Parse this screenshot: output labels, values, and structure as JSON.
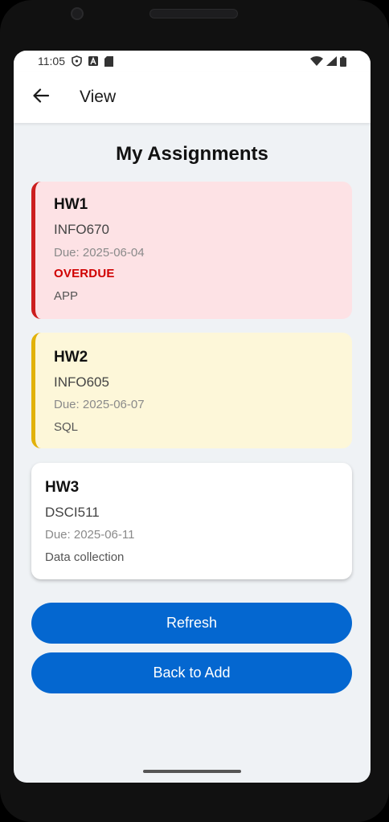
{
  "status_bar": {
    "time": "11:05",
    "left_icons": [
      "shield-icon",
      "a-badge-icon",
      "sd-card-icon"
    ],
    "right_icons": [
      "wifi-icon",
      "signal-icon",
      "battery-icon"
    ]
  },
  "app_bar": {
    "back_icon": "arrow-left-icon",
    "title": "View"
  },
  "page_title": "My Assignments",
  "assignments": [
    {
      "title": "HW1",
      "course": "INFO670",
      "due": "Due: 2025-06-04",
      "status": "OVERDUE",
      "description": "APP",
      "accent_color": "#cc1f1f",
      "background": "#fde2e5"
    },
    {
      "title": "HW2",
      "course": "INFO605",
      "due": "Due: 2025-06-07",
      "description": "SQL",
      "accent_color": "#e2b20a",
      "background": "#fdf7d9"
    },
    {
      "title": "HW3",
      "course": "DSCI511",
      "due": "Due: 2025-06-11",
      "description": "Data collection",
      "background": "#ffffff"
    }
  ],
  "buttons": {
    "refresh": "Refresh",
    "back_to_add": "Back to Add"
  },
  "colors": {
    "primary": "#0467d0",
    "overdue_text": "#d00000",
    "screen_background": "#eff2f5"
  }
}
